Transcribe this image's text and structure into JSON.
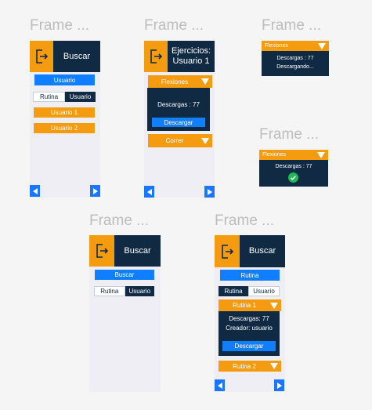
{
  "frame_title": "Frame ...",
  "f1": {
    "header": "Buscar",
    "usuario": "Usuario",
    "tab_rutina": "Rutina",
    "tab_usuario": "Usuario",
    "items": [
      "Usuario 1",
      "Usuario 2"
    ]
  },
  "f2": {
    "header": "Ejercicios:\nUsuario 1",
    "dd1": "Flexiones",
    "descargas": "Descargas : 77",
    "descargar": "Descargar",
    "dd2": "Correr"
  },
  "f3": {
    "dd": "Flexiones",
    "descargas": "Descargas : 77",
    "status": "Descargando..."
  },
  "f4": {
    "dd": "Flexiones",
    "descargas": "Descargas : 77"
  },
  "f5": {
    "header": "Buscar",
    "search": "Buscar",
    "tab_rutina": "Rutina",
    "tab_usuario": "Usuario"
  },
  "f6": {
    "header": "Buscar",
    "rutina": "Rutina",
    "tab_rutina": "Rutina",
    "tab_usuario": "Usuario",
    "dd1": "Rutina 1",
    "descargas": "Descargas: 77",
    "creador": "Creador: usuario",
    "descargar": "Descargar",
    "dd2": "Rutina 2"
  },
  "colors": {
    "orange": "#F59B0F",
    "navy": "#102A43",
    "blue": "#0F7FFF",
    "success": "#1DB954"
  },
  "icons": [
    "logout-icon",
    "chevron-left-icon",
    "chevron-right-icon",
    "caret-down-icon",
    "check-circle-icon"
  ]
}
